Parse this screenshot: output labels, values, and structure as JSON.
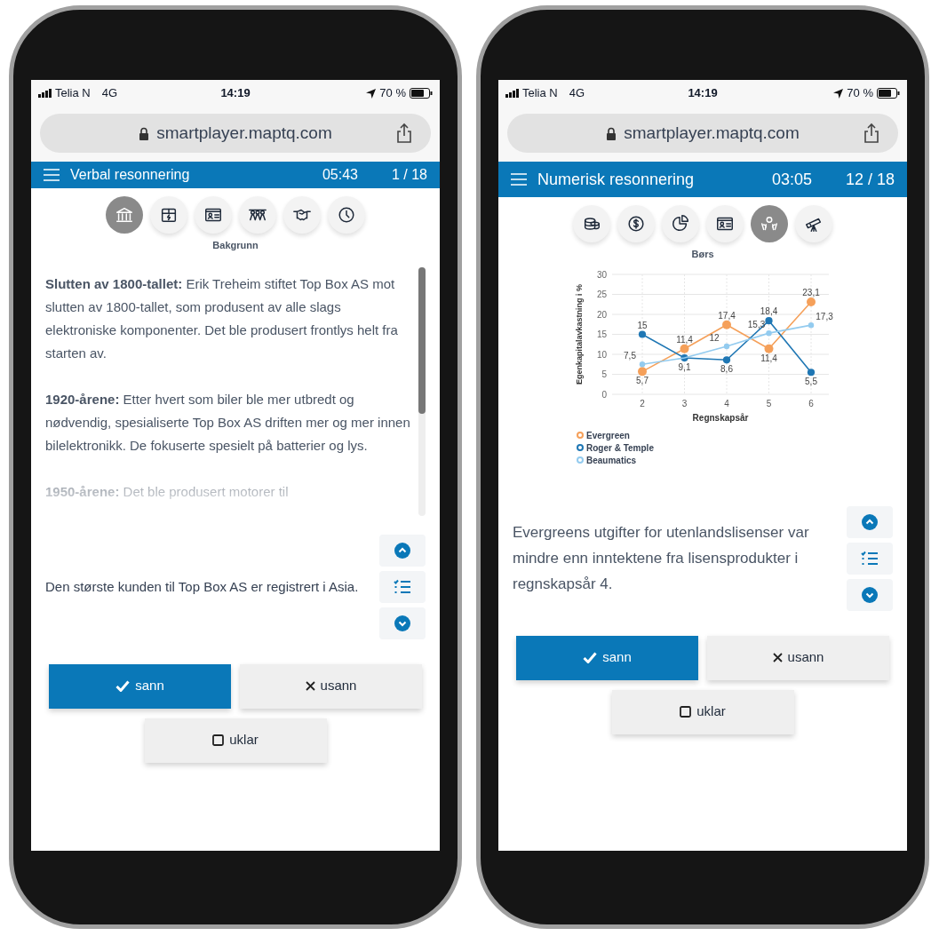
{
  "phones": [
    {
      "status_bar": {
        "carrier": "Telia N",
        "network": "4G",
        "time": "14:19",
        "battery": "70 %"
      },
      "url": "smartplayer.maptq.com",
      "header": {
        "title": "Verbal resonnering",
        "timer": "05:43",
        "progress": "1 / 18"
      },
      "tabs": [
        {
          "kind": "bank",
          "selected": true
        },
        {
          "kind": "box",
          "selected": false
        },
        {
          "kind": "idcard",
          "selected": false
        },
        {
          "kind": "people",
          "selected": false
        },
        {
          "kind": "handshake",
          "selected": false
        },
        {
          "kind": "clock",
          "selected": false
        }
      ],
      "tab_caption": "Bakgrunn",
      "passage": [
        "**Slutten av 1800-tallet:** Erik Treheim stiftet Top Box AS mot slutten av 1800-tallet, som produsent av alle slags elektroniske komponenter. Det ble produsert frontlys helt fra starten av.",
        "**1920-årene:** Etter hvert som biler ble mer utbredt og nødvendig, spesialiserte Top Box AS driften mer og mer innen bilelektronikk. De fokuserte spesielt på batterier og lys.",
        "**1950-årene:** Det ble produsert motorer til"
      ],
      "statement": "Den største kunden til Top Box AS er registrert i Asia.",
      "answers": [
        {
          "kind": "true",
          "label": "sann",
          "selected": true
        },
        {
          "kind": "false",
          "label": "usann",
          "selected": false
        },
        {
          "kind": "unclear",
          "label": "uklar",
          "selected": false
        }
      ]
    },
    {
      "status_bar": {
        "carrier": "Telia N",
        "network": "4G",
        "time": "14:19",
        "battery": "70 %"
      },
      "url": "smartplayer.maptq.com",
      "header": {
        "title": "Numerisk resonnering",
        "timer": "03:05",
        "progress": "12 / 18"
      },
      "tabs": [
        {
          "kind": "coins",
          "selected": false
        },
        {
          "kind": "dollar",
          "selected": false
        },
        {
          "kind": "pie",
          "selected": false
        },
        {
          "kind": "idcard",
          "selected": false
        },
        {
          "kind": "handsmoney",
          "selected": true
        },
        {
          "kind": "telescope",
          "selected": false
        }
      ],
      "tab_caption": "Børs",
      "chart_data": {
        "type": "line",
        "grid": true,
        "xlabel": "Regnskapsår",
        "ylabel": "Egenkapitalavkastning i %",
        "categories": [
          "2",
          "3",
          "4",
          "5",
          "6"
        ],
        "ylim": [
          0,
          30
        ],
        "yticks": [
          0,
          5,
          10,
          15,
          20,
          25,
          30
        ],
        "series": [
          {
            "name": "Evergreen",
            "color": "#f5a05a",
            "marker": "circle",
            "values": [
              5.7,
              11.4,
              17.4,
              11.4,
              23.1
            ]
          },
          {
            "name": "Roger & Temple",
            "color": "#1f77b4",
            "marker": "circle",
            "values": [
              15,
              9.1,
              8.6,
              18.4,
              5.5
            ]
          },
          {
            "name": "Beaumatics",
            "color": "#93cbef",
            "marker": "circle",
            "values": [
              7.5,
              9.1,
              12,
              15.3,
              17.3
            ]
          }
        ],
        "annotations": [
          {
            "x": "2",
            "y": 5.7,
            "text": "5,7"
          },
          {
            "x": "3",
            "y": 11.4,
            "text": "11,4"
          },
          {
            "x": "4",
            "y": 17.4,
            "text": "17,4"
          },
          {
            "x": "5",
            "y": 11.4,
            "text": "11,4"
          },
          {
            "x": "6",
            "y": 23.1,
            "text": "23,1"
          },
          {
            "x": "2",
            "y": 15,
            "text": "15"
          },
          {
            "x": "3",
            "y": 9.1,
            "text": "9,1"
          },
          {
            "x": "4",
            "y": 8.6,
            "text": "8,6"
          },
          {
            "x": "5",
            "y": 18.4,
            "text": "18,4"
          },
          {
            "x": "6",
            "y": 5.5,
            "text": "5,5"
          },
          {
            "x": "2",
            "y": 7.5,
            "text": "7,5"
          },
          {
            "x": "4",
            "y": 12,
            "text": "12"
          },
          {
            "x": "5",
            "y": 15.3,
            "text": "15,3"
          },
          {
            "x": "6",
            "y": 17.3,
            "text": "17,3"
          }
        ]
      },
      "statement": "Evergreens utgifter for utenlandslisenser var mindre enn inntektene fra lisensprodukter i regnskapsår 4.",
      "answers": [
        {
          "kind": "true",
          "label": "sann",
          "selected": true
        },
        {
          "kind": "false",
          "label": "usann",
          "selected": false
        },
        {
          "kind": "unclear",
          "label": "uklar",
          "selected": false
        }
      ]
    }
  ]
}
